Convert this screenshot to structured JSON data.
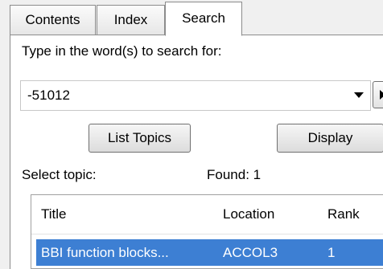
{
  "tabs": {
    "contents": "Contents",
    "index": "Index",
    "search": "Search"
  },
  "search": {
    "prompt": "Type in the word(s) to search for:",
    "query": "-51012"
  },
  "buttons": {
    "list_topics": "List Topics",
    "display": "Display"
  },
  "results": {
    "select_label": "Select topic:",
    "found_label": "Found: 1",
    "columns": {
      "title": "Title",
      "location": "Location",
      "rank": "Rank"
    },
    "rows": [
      {
        "title": "BBI function blocks...",
        "location": "ACCOL3",
        "rank": "1"
      }
    ]
  },
  "colors": {
    "selection": "#3d7fd3",
    "panel": "#ffffff",
    "chrome": "#f0f0f0"
  }
}
